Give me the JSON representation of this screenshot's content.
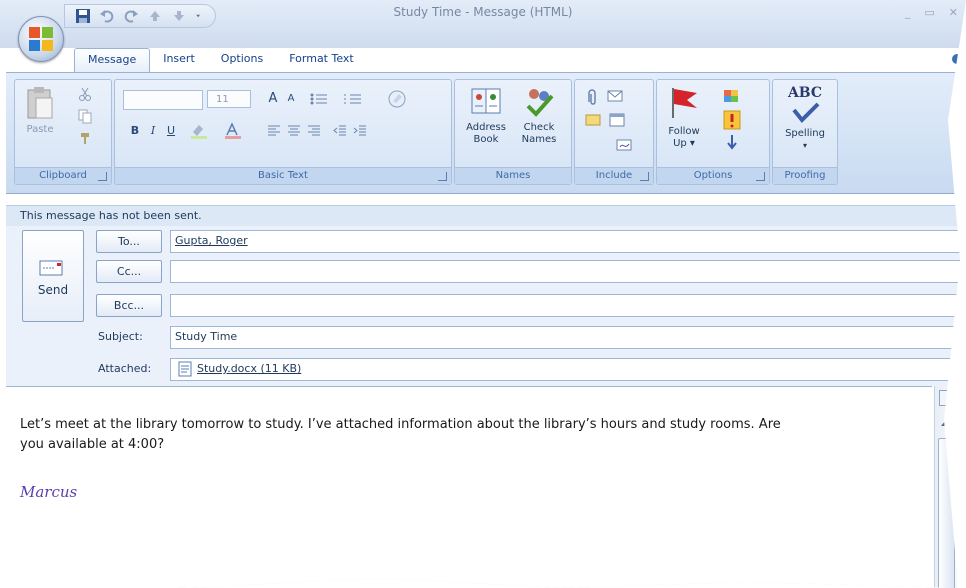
{
  "window": {
    "title": "Study Time - Message (HTML)",
    "controls": [
      "_",
      "▭",
      "✕"
    ]
  },
  "quick_access": [
    "save-icon",
    "undo-icon",
    "redo-icon",
    "up-arrow-icon",
    "down-arrow-icon",
    "customize-icon"
  ],
  "tabs": [
    {
      "label": "Message",
      "active": true
    },
    {
      "label": "Insert",
      "active": false
    },
    {
      "label": "Options",
      "active": false
    },
    {
      "label": "Format Text",
      "active": false
    }
  ],
  "ribbon": {
    "clipboard": {
      "label": "Clipboard",
      "paste": "Paste"
    },
    "basic_text": {
      "label": "Basic Text",
      "font_size": "11",
      "grow": "A",
      "shrink": "A",
      "bold": "B",
      "italic": "I",
      "underline": "U"
    },
    "names": {
      "label": "Names",
      "address_book_1": "Address",
      "address_book_2": "Book",
      "check_names_1": "Check",
      "check_names_2": "Names"
    },
    "include": {
      "label": "Include"
    },
    "options": {
      "label": "Options",
      "follow_up_1": "Follow",
      "follow_up_2": "Up ▾"
    },
    "proofing": {
      "label": "Proofing",
      "spelling": "Spelling",
      "abc": "ABC"
    }
  },
  "message": {
    "notice": "This message has not been sent.",
    "send_label": "Send",
    "to_button": "To...",
    "cc_button": "Cc...",
    "bcc_button": "Bcc...",
    "to_value": "Gupta, Roger",
    "cc_value": "",
    "bcc_value": "",
    "subject_label": "Subject:",
    "subject_value": "Study Time",
    "attached_label": "Attached:",
    "attachment": "Study.docx (11 KB)",
    "body_line1": "Let’s meet at the library tomorrow to study. I’ve attached information about the library’s hours and study rooms. Are",
    "body_line2": "you available at 4:00?",
    "signature": "Marcus"
  },
  "colors": {
    "ribbon_bg": "#d6e4f5",
    "accent": "#15428b",
    "signature": "#5b3fae",
    "flag": "#d4232a"
  }
}
